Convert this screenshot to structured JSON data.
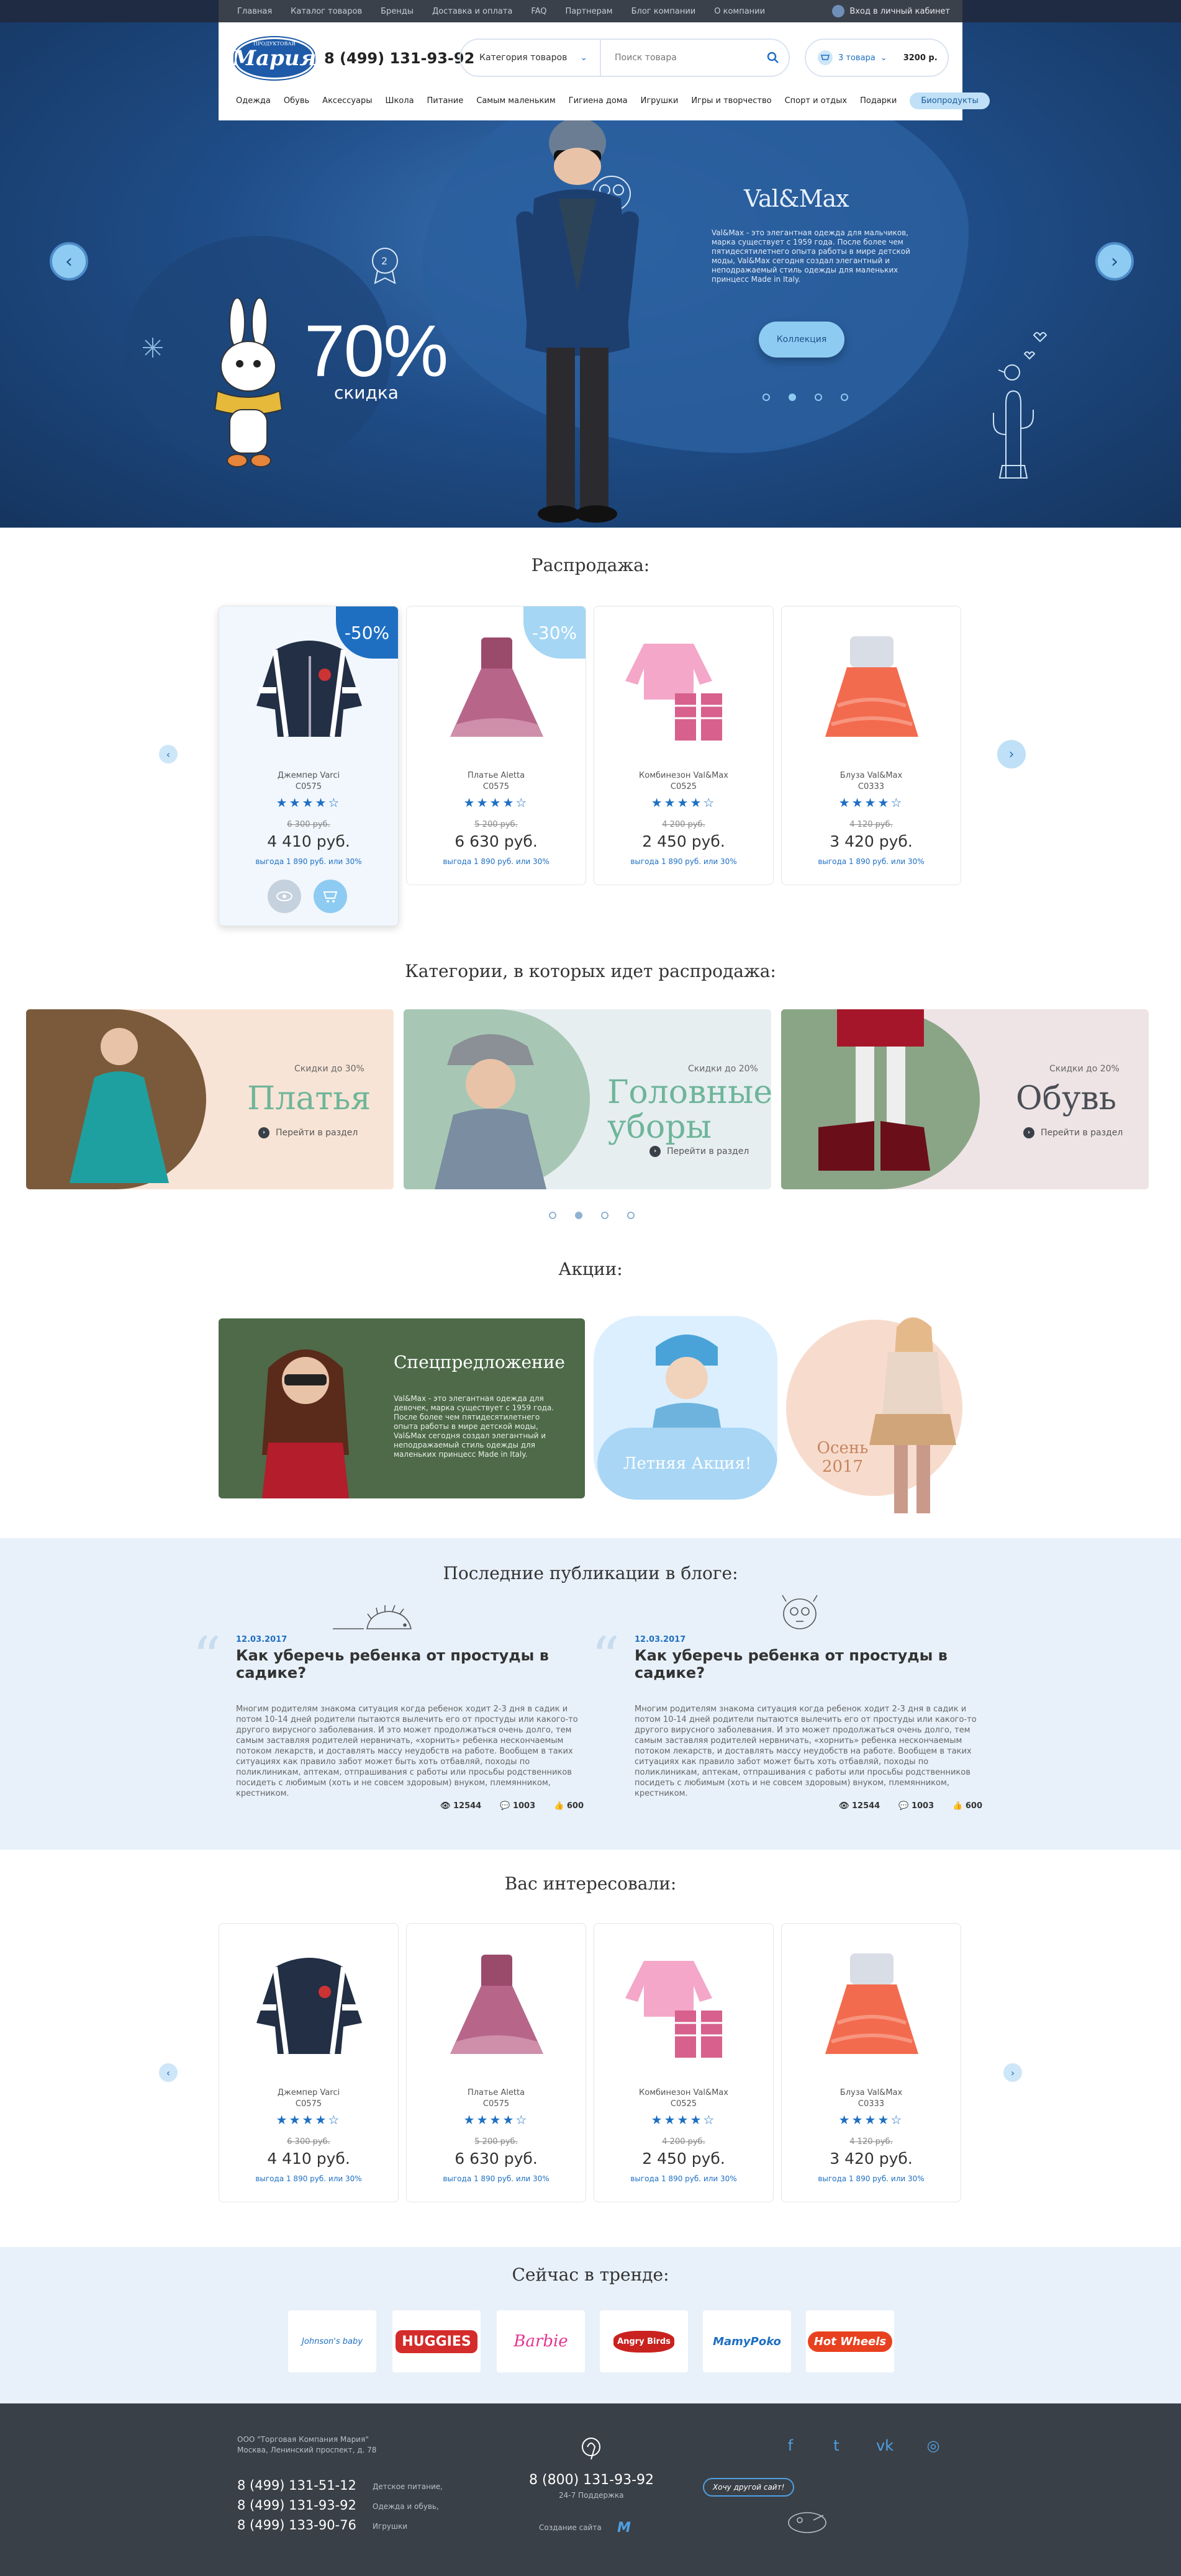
{
  "topnav": {
    "links": [
      "Главная",
      "Каталог товаров",
      "Бренды",
      "Доставка и оплата",
      "FAQ",
      "Партнерам",
      "Блог компании",
      "О компании"
    ],
    "cabinet": "Вход в личный кабинет"
  },
  "header": {
    "logo_text": "Мария",
    "logo_sub": "ПРОДУКТОВАЯ",
    "phone": "8 (499) 131-93-92",
    "category_select": "Категория товаров",
    "search_placeholder": "Поиск товара",
    "cart_items": "3 товара",
    "cart_sum": "3200 р.",
    "categories": [
      "Одежда",
      "Обувь",
      "Аксессуары",
      "Школа",
      "Питание",
      "Самым маленьким",
      "Гигиена дома",
      "Игрушки",
      "Игры и творчество",
      "Спорт и отдых",
      "Подарки",
      "Биопродукты"
    ]
  },
  "hero": {
    "discount": "70%",
    "discount_label": "скидка",
    "brand": "Val&Max",
    "text": "Val&Max - это элегантная одежда для мальчиков, марка существует с 1959 года. После более чем пятидесятилетнего опыта работы в мире детской моды, Val&Max сегодня создал элегантный и неподражаемый стиль одежды для маленьких принцесс Made in Italy.",
    "button": "Коллекция",
    "slide_count": 4,
    "active_slide": 2
  },
  "sale": {
    "title": "Распродажа:",
    "products": [
      {
        "name": "Джемпер Varci",
        "code": "C0575",
        "old": "6 300 руб.",
        "price": "4 410 руб.",
        "benefit": "выгода 1 890 руб. или 30%",
        "badge": "-50%",
        "rating": 4
      },
      {
        "name": "Платье Aletta",
        "code": "C0575",
        "old": "5 200 руб.",
        "price": "6 630 руб.",
        "benefit": "выгода 1 890 руб. или 30%",
        "badge": "-30%",
        "rating": 4
      },
      {
        "name": "Комбинезон Val&Max",
        "code": "C0525",
        "old": "4 200 руб.",
        "price": "2 450 руб.",
        "benefit": "выгода 1 890 руб. или 30%",
        "badge": "",
        "rating": 4
      },
      {
        "name": "Блуза Val&Max",
        "code": "C0333",
        "old": "4 120 руб.",
        "price": "3 420 руб.",
        "benefit": "выгода 1 890 руб. или 30%",
        "badge": "",
        "rating": 4
      }
    ]
  },
  "categories": {
    "title": "Категории, в которых идет распродажа:",
    "items": [
      {
        "title": "Платья",
        "discount": "Скидки до 30%",
        "link": "Перейти в раздел"
      },
      {
        "title": "Головные уборы",
        "discount": "Скидки до 20%",
        "link": "Перейти в раздел"
      },
      {
        "title": "Обувь",
        "discount": "Скидки до 20%",
        "link": "Перейти в раздел"
      }
    ]
  },
  "promos": {
    "title": "Акции:",
    "special_title": "Спецпредложение",
    "special_text": "Val&Max - это элегантная одежда для девочек, марка существует с 1959 года. После более чем пятидесятилетнего опыта работы в мире детской моды, Val&Max сегодня создал элегантный и неподражаемый стиль одежды для маленьких принцесс Made in Italy.",
    "summer": "Летняя Акция!",
    "autumn": "Осень 2017"
  },
  "blog": {
    "title": "Последние публикации в блоге:",
    "posts": [
      {
        "date": "12.03.2017",
        "title": "Как уберечь ребенка от простуды в садике?",
        "text": "Многим родителям знакома ситуация когда ребенок ходит 2-3 дня в садик и потом 10-14 дней родители пытаются вылечить его от простуды или какого-то другого вирусного заболевания. И это может продолжаться очень долго, тем самым заставляя родителей нервничать, «хорнить» ребенка нескончаемым потоком лекарств, и доставлять массу неудобств на работе. Вообщем в таких ситуациях как правило забот может быть хоть отбавляй, походы по поликлиникам, аптекам, отпрашивания с работы или просьбы родственников посидеть с любимым (хоть и не совсем здоровым) внуком, племянником, крестником.",
        "views": "12544",
        "comments": "1003",
        "likes": "600"
      },
      {
        "date": "12.03.2017",
        "title": "Как уберечь ребенка от простуды в садике?",
        "text": "Многим родителям знакома ситуация когда ребенок ходит 2-3 дня в садик и потом 10-14 дней родители пытаются вылечить его от простуды или какого-то другого вирусного заболевания. И это может продолжаться очень долго, тем самым заставляя родителей нервничать, «хорнить» ребенка нескончаемым потоком лекарств, и доставлять массу неудобств на работе. Вообщем в таких ситуациях как правило забот может быть хоть отбавляй, походы по поликлиникам, аптекам, отпрашивания с работы или просьбы родственников посидеть с любимым (хоть и не совсем здоровым) внуком, племянником, крестником.",
        "views": "12544",
        "comments": "1003",
        "likes": "600"
      }
    ]
  },
  "interested": {
    "title": "Вас интересовали:",
    "products": [
      {
        "name": "Джемпер Varci",
        "code": "C0575",
        "old": "6 300 руб.",
        "price": "4 410 руб.",
        "benefit": "выгода 1 890 руб. или 30%",
        "rating": 4
      },
      {
        "name": "Платье Aletta",
        "code": "C0575",
        "old": "5 200 руб.",
        "price": "6 630 руб.",
        "benefit": "выгода 1 890 руб. или 30%",
        "rating": 4
      },
      {
        "name": "Комбинезон Val&Max",
        "code": "C0525",
        "old": "4 200 руб.",
        "price": "2 450 руб.",
        "benefit": "выгода 1 890 руб. или 30%",
        "rating": 4
      },
      {
        "name": "Блуза Val&Max",
        "code": "C0333",
        "old": "4 120 руб.",
        "price": "3 420 руб.",
        "benefit": "выгода 1 890 руб. или 30%",
        "rating": 4
      }
    ]
  },
  "trend": {
    "title": "Сейчас в тренде:",
    "brands": [
      "Johnson's baby",
      "HUGGIES",
      "Barbie",
      "Angry Birds",
      "MamyPoko",
      "Hot Wheels"
    ]
  },
  "footer": {
    "company": "ООО \"Торговая Компания Мария\"",
    "address": "Москва, Ленинский проспект, д. 78",
    "phones": [
      {
        "number": "8 (499) 131-51-12",
        "label": "Детское питание,"
      },
      {
        "number": "8 (499) 131-93-92",
        "label": "Одежда и обувь,"
      },
      {
        "number": "8 (499) 133-90-76",
        "label": "Игрушки"
      }
    ],
    "hotline": "8 (800) 131-93-92",
    "support": "24-7 Поддержка",
    "created": "Создание сайта",
    "want": "Хочу другой сайт!"
  },
  "colors": {
    "accent": "#1e6fc2",
    "light_accent": "#8ecbf2",
    "hero_bg": "#1f4d88",
    "footer": "#3a4047",
    "blog_bg": "#e8f1fa"
  }
}
